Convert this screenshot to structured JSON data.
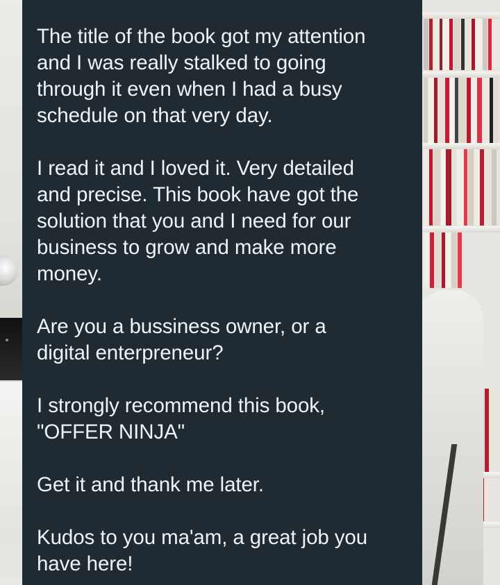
{
  "message": {
    "paragraphs": [
      "The title of the book got my attention\nand I was really stalked to going\nthrough it even when I had a busy\nschedule on that very day.",
      "I read it and I loved it. Very detailed\nand precise. This book have got the\nsolution that you and I need for our\nbusiness to grow and make more\nmoney.",
      "Are you a bussiness owner, or a\ndigital enterpreneur?",
      "I strongly recommend this book,\n\"OFFER NINJA\"",
      "Get it and thank me later.",
      "Kudos to you ma'am, a great job you\nhave here!"
    ]
  },
  "colors": {
    "bubble_background": "#1f2a33",
    "text": "#f1f3f4"
  }
}
